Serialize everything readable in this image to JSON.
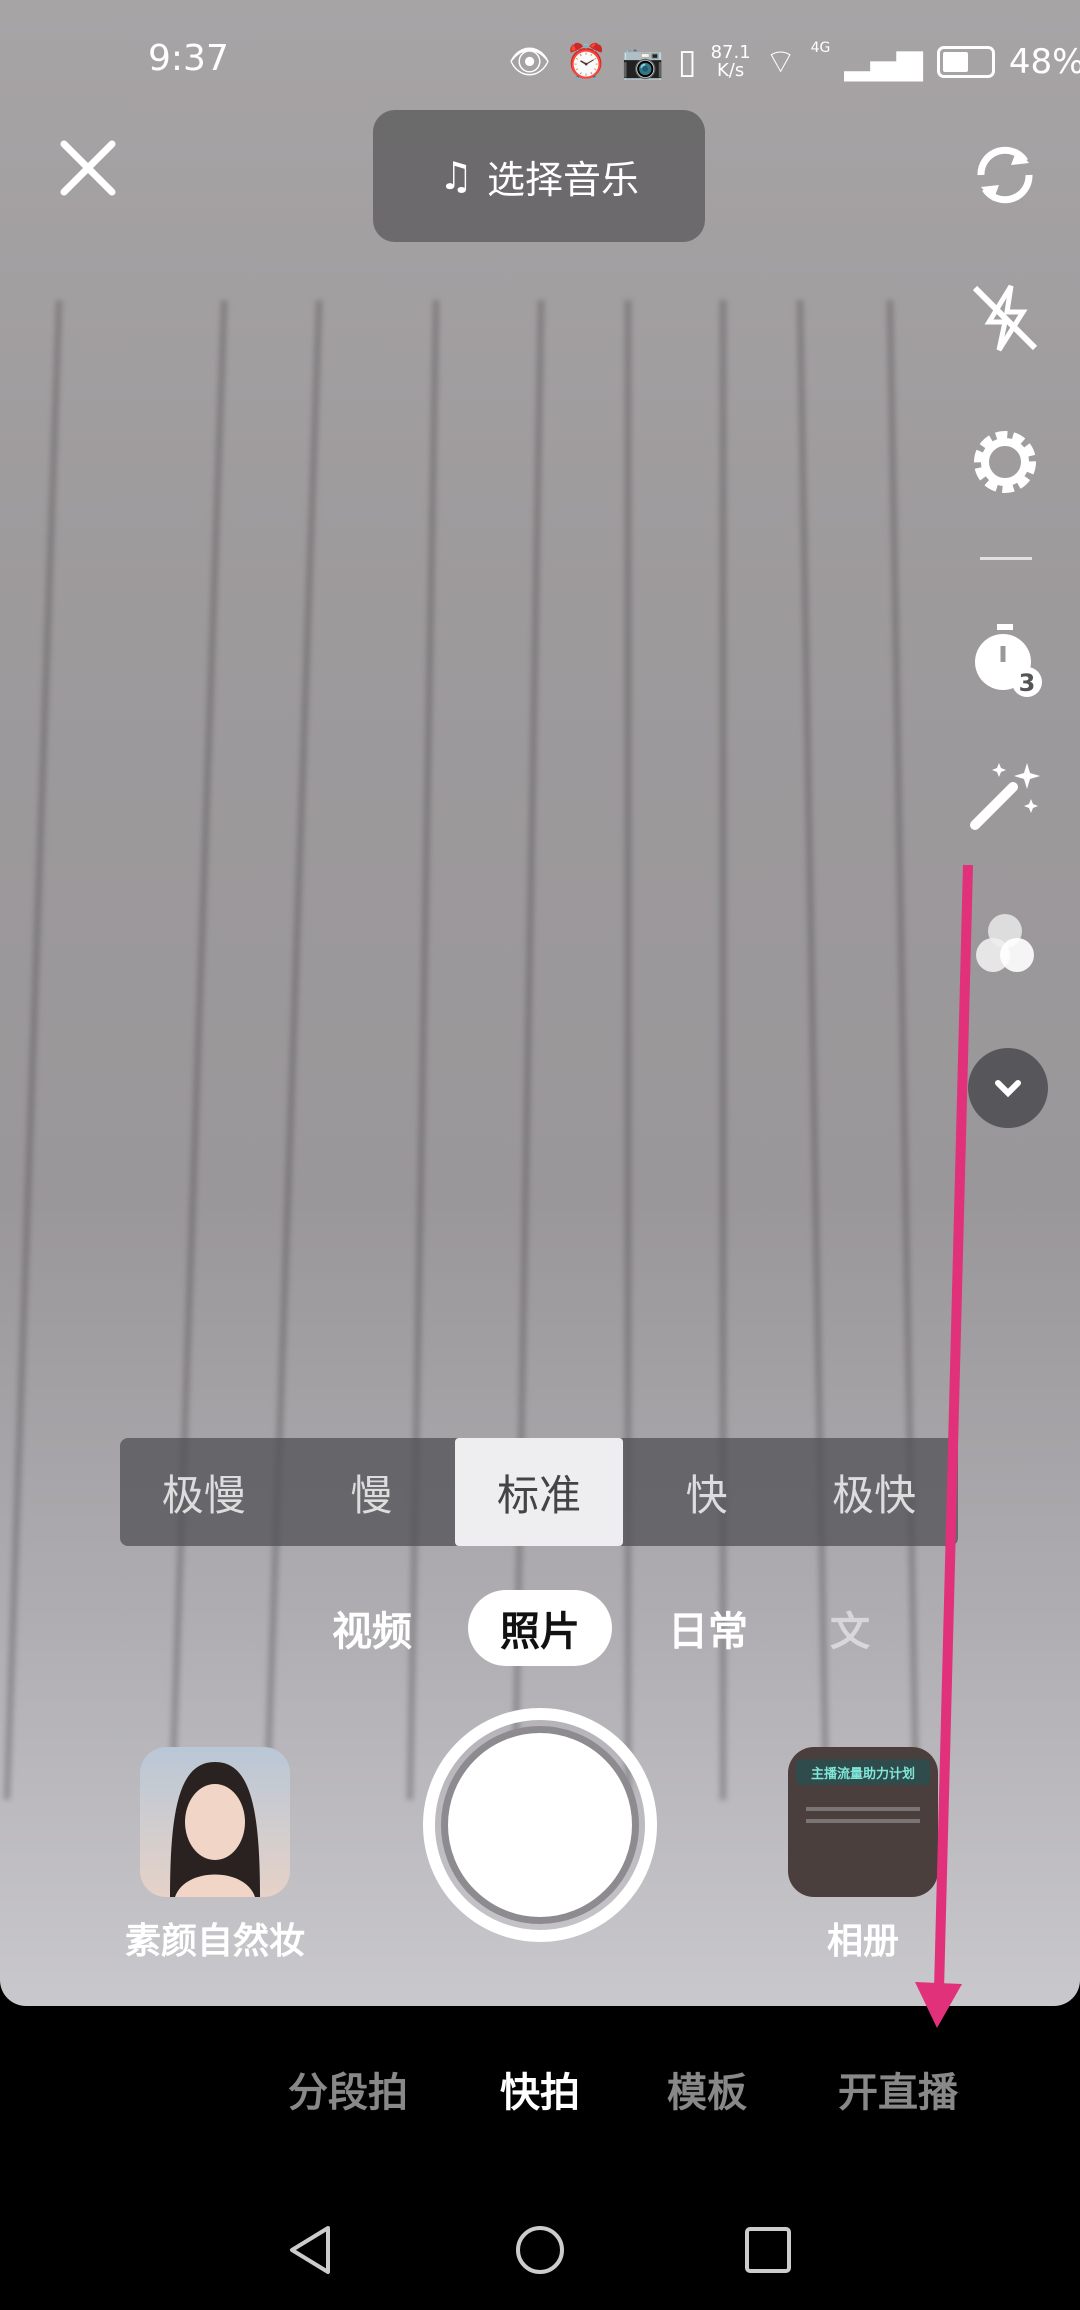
{
  "status_bar": {
    "time": "9:37",
    "net_speed_value": "87.1",
    "net_speed_unit": "K/s",
    "network": "4G",
    "battery": "48%",
    "battery_level": 0.48,
    "icons": [
      "eye-icon",
      "alarm-icon",
      "camera-icon",
      "vibrate-icon",
      "wifi-icon",
      "signal-icon",
      "battery-icon"
    ]
  },
  "camera": {
    "close_icon": "close-icon",
    "music_button": "选择音乐",
    "right_toolbar": [
      "flip-camera-icon",
      "flash-off-icon",
      "gear-icon",
      "timer-3s-icon",
      "magic-wand-icon",
      "filter-icon",
      "chevron-down-icon"
    ],
    "speed_options": [
      "极慢",
      "慢",
      "标准",
      "快",
      "极快"
    ],
    "speed_selected": "标准",
    "modes": [
      "视频",
      "照片",
      "日常",
      "文"
    ],
    "mode_selected": "照片",
    "beauty_label": "素颜自然妆",
    "album_label": "相册",
    "album_thumb_text": "主播流量助力计划"
  },
  "bottom_tabs": [
    "分段拍",
    "快拍",
    "模板",
    "开直播"
  ],
  "bottom_tab_selected": "快拍",
  "nav": [
    "back-icon",
    "home-icon",
    "recents-icon"
  ],
  "annotation": {
    "arrow_color": "#e0317a"
  }
}
